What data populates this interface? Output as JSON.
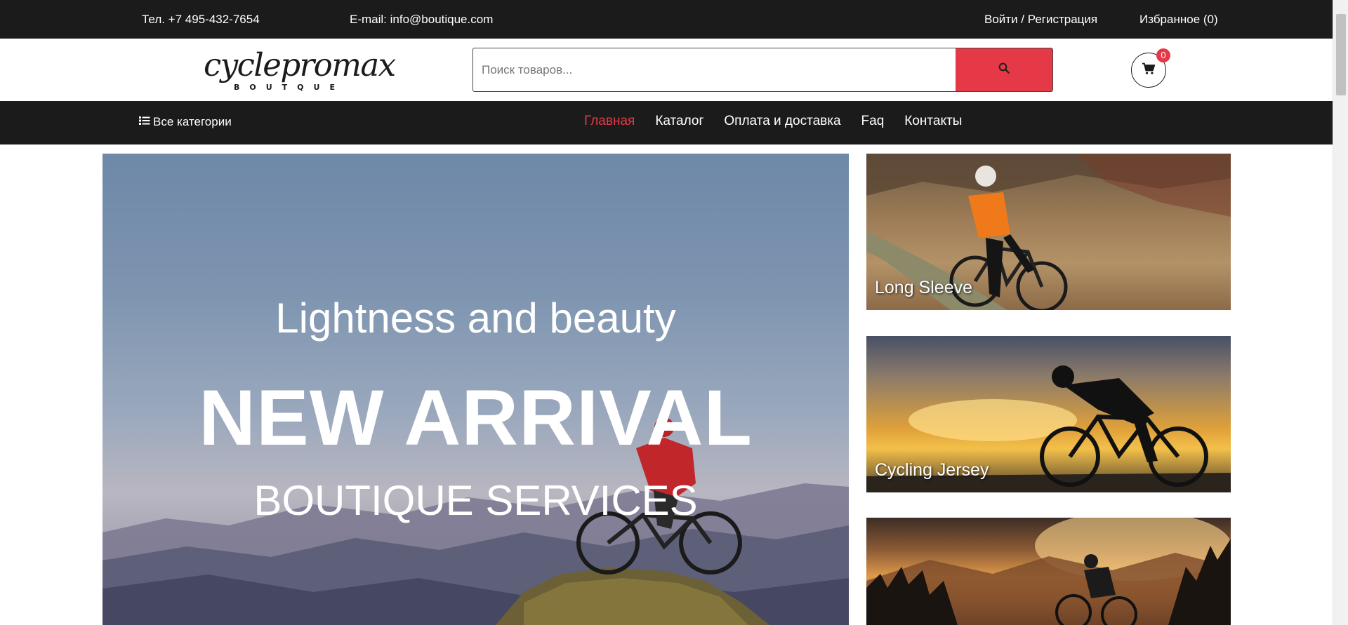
{
  "topbar": {
    "phone": "Тел. +7 495-432-7654",
    "email": "E-mail: info@boutique.com",
    "login": "Войти / Регистрация",
    "favorites": "Избранное (0)"
  },
  "header": {
    "logo_main": "cyclepromax",
    "logo_sub": "BOUTQUE",
    "search_placeholder": "Поиск товаров...",
    "search_value": "",
    "cart_count": "0",
    "icons": {
      "search": "search-icon",
      "cart": "cart-icon"
    }
  },
  "nav": {
    "all_categories": "Все категории",
    "links": [
      {
        "label": "Главная",
        "active": true
      },
      {
        "label": "Каталог",
        "active": false
      },
      {
        "label": "Оплата и доставка",
        "active": false
      },
      {
        "label": "Faq",
        "active": false
      },
      {
        "label": "Контакты",
        "active": false
      }
    ]
  },
  "hero": {
    "line1": "Lightness and beauty",
    "line2": "NEW ARRIVAL",
    "line3": "BOUTIQUE SERVICES"
  },
  "tiles": [
    {
      "caption": "Long Sleeve"
    },
    {
      "caption": "Cycling Jersey"
    },
    {
      "caption": ""
    }
  ],
  "colors": {
    "dark_bar": "#1b1b1b",
    "accent": "#e63947",
    "white": "#ffffff"
  }
}
